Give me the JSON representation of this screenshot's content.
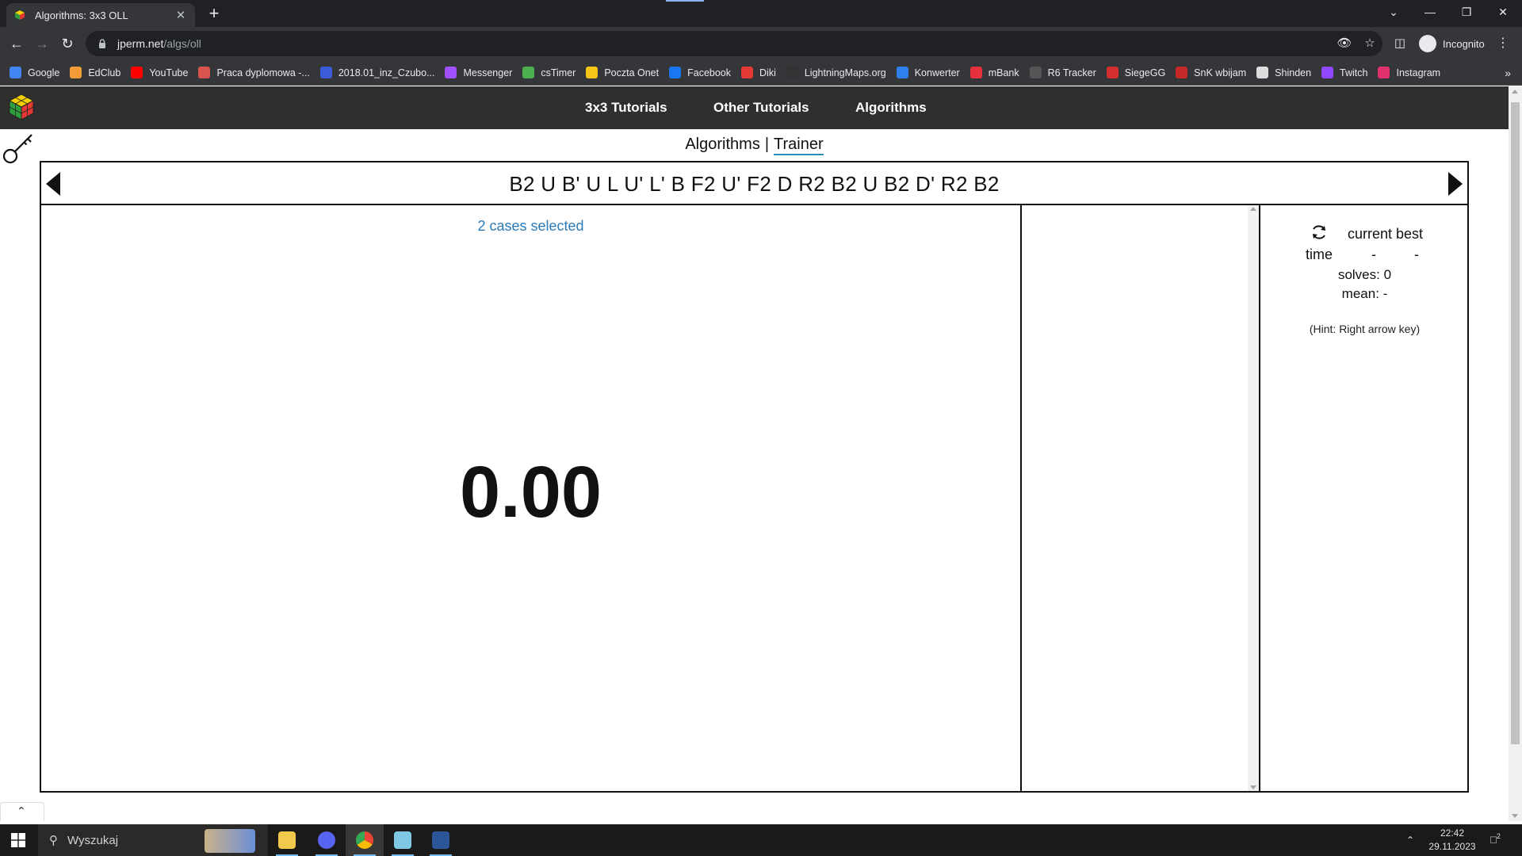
{
  "browser": {
    "tab_title": "Algorithms: 3x3 OLL",
    "tab_close": "✕",
    "new_tab": "+",
    "url_host": "jperm.net",
    "url_path": "/algs/oll",
    "profile_label": "Incognito",
    "bookmarks": [
      {
        "label": "Google",
        "color": "#4285f4"
      },
      {
        "label": "EdClub",
        "color": "#f29c38"
      },
      {
        "label": "YouTube",
        "color": "#ff0000"
      },
      {
        "label": "Praca dyplomowa -...",
        "color": "#d9534f"
      },
      {
        "label": "2018.01_inz_Czubo...",
        "color": "#3b5bdb"
      },
      {
        "label": "Messenger",
        "color": "#a050ff"
      },
      {
        "label": "csTimer",
        "color": "#4caf50"
      },
      {
        "label": "Poczta Onet",
        "color": "#f5c518"
      },
      {
        "label": "Facebook",
        "color": "#1877f2"
      },
      {
        "label": "Diki",
        "color": "#e53935"
      },
      {
        "label": "LightningMaps.org",
        "color": "#333333"
      },
      {
        "label": "Konwerter",
        "color": "#2f80ed"
      },
      {
        "label": "mBank",
        "color": "#e5303d"
      },
      {
        "label": "R6 Tracker",
        "color": "#555555"
      },
      {
        "label": "SiegeGG",
        "color": "#d32f2f"
      },
      {
        "label": "SnK wbijam",
        "color": "#c62828"
      },
      {
        "label": "Shinden",
        "color": "#dddddd"
      },
      {
        "label": "Twitch",
        "color": "#9146ff"
      },
      {
        "label": "Instagram",
        "color": "#e1306c"
      }
    ],
    "bookmarks_more": "»"
  },
  "site": {
    "nav": [
      "3x3 Tutorials",
      "Other Tutorials",
      "Algorithms"
    ],
    "subnav": {
      "algorithms": "Algorithms",
      "separator": "|",
      "trainer": "Trainer"
    }
  },
  "trainer": {
    "scramble": "B2 U B' U L U' L' B F2 U' F2 D R2 B2 U B2 D' R2 B2",
    "cases_selected": "2 cases selected",
    "timer": "0.00",
    "stats": {
      "current_best": "current best",
      "time_label": "time",
      "current_time": "-",
      "best_time": "-",
      "solves": "solves: 0",
      "mean": "mean: -",
      "hint": "(Hint: Right arrow key)"
    }
  },
  "taskbar": {
    "search_placeholder": "Wyszukaj",
    "time": "22:42",
    "date": "29.11.2023",
    "notifications": "2"
  },
  "colors": {
    "accent_blue": "#2b7bb9",
    "site_nav_bg": "#2f2f2f",
    "chrome_dark": "#202124"
  }
}
